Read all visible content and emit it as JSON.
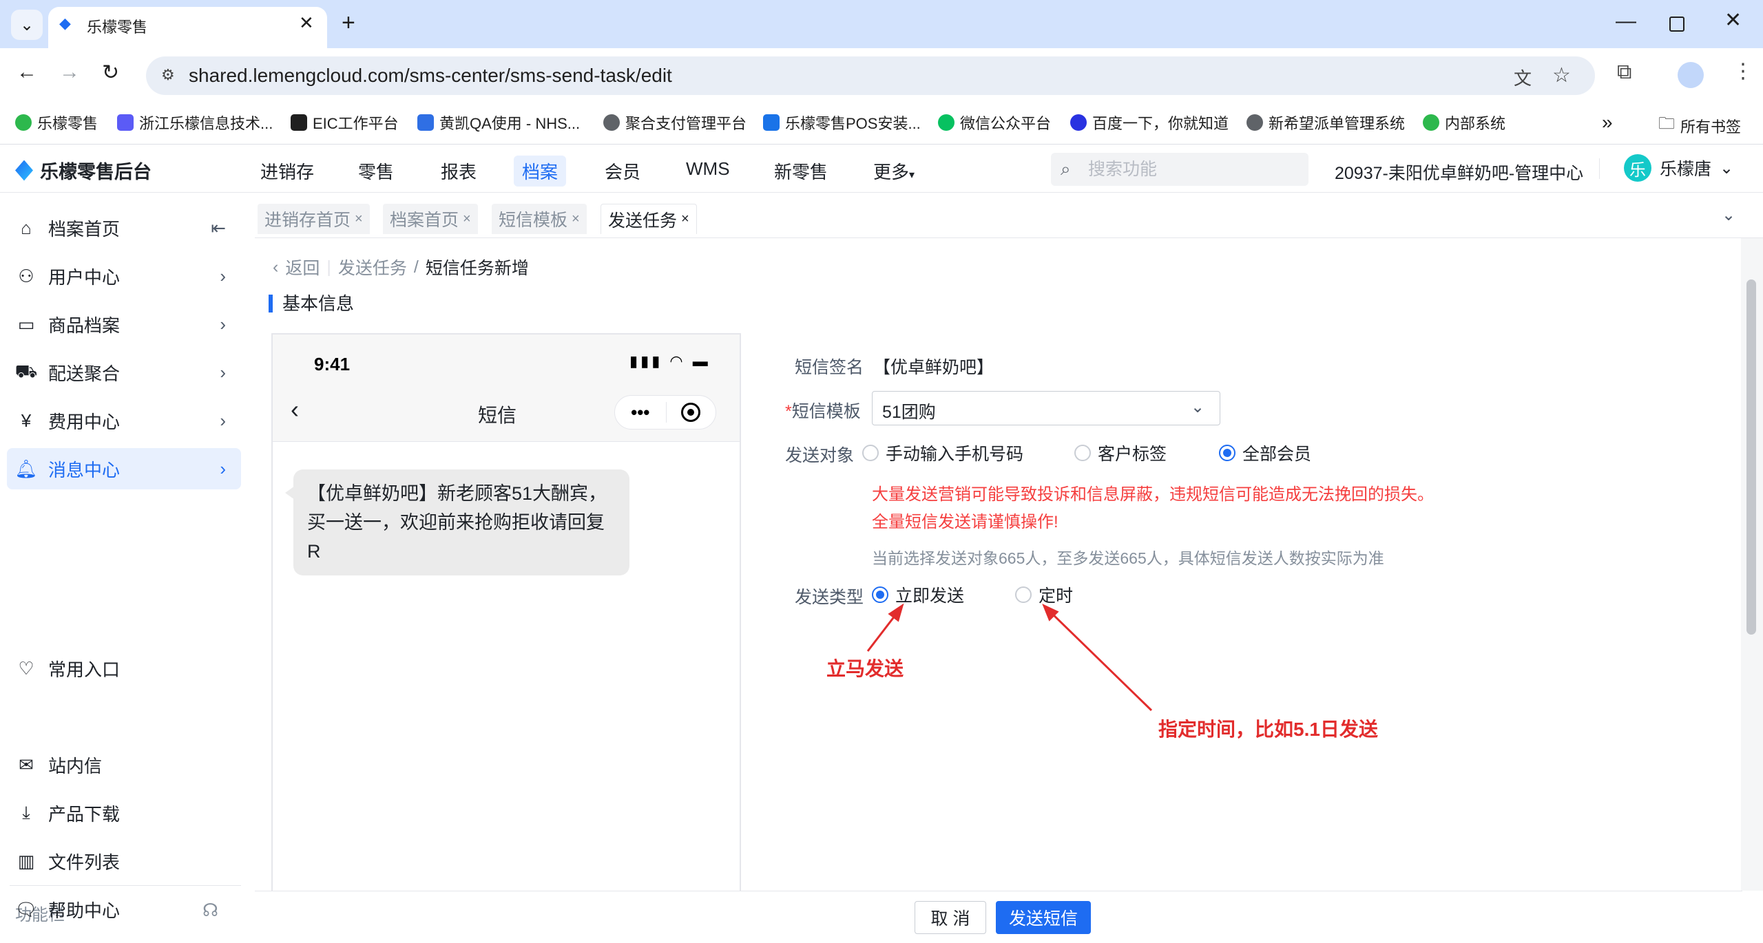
{
  "browser": {
    "tab_title": "乐檬零售",
    "url": "shared.lemengcloud.com/sms-center/sms-send-task/edit",
    "bookmarks": [
      "乐檬零售",
      "浙江乐檬信息技术...",
      "EIC工作平台",
      "黄凯QA使用 - NHS...",
      "聚合支付管理平台",
      "乐檬零售POS安装...",
      "微信公众平台",
      "百度一下，你就知道",
      "新希望派单管理系统",
      "内部系统"
    ],
    "bookmarks_more": "»",
    "all_bookmarks": "所有书签"
  },
  "app": {
    "logo": "乐檬零售后台",
    "nav": [
      "进销存",
      "零售",
      "报表",
      "档案",
      "会员",
      "WMS",
      "新零售",
      "更多"
    ],
    "active_nav": "档案",
    "search_placeholder": "搜索功能",
    "store_name": "20937-耒阳优卓鲜奶吧-管理中心",
    "user_avatar": "乐",
    "user_name": "乐檬唐"
  },
  "sidebar": {
    "items": [
      {
        "label": "档案首页",
        "icon": "home-icon"
      },
      {
        "label": "用户中心",
        "icon": "user-icon"
      },
      {
        "label": "商品档案",
        "icon": "box-icon"
      },
      {
        "label": "配送聚合",
        "icon": "truck-icon"
      },
      {
        "label": "费用中心",
        "icon": "yen-icon"
      },
      {
        "label": "消息中心",
        "icon": "bell-icon"
      }
    ],
    "favorites": "常用入口",
    "section": "功能栏",
    "tools": [
      {
        "label": "站内信",
        "icon": "mail-icon"
      },
      {
        "label": "产品下载",
        "icon": "download-icon"
      },
      {
        "label": "文件列表",
        "icon": "chart-icon"
      },
      {
        "label": "帮助中心",
        "icon": "help-icon"
      }
    ]
  },
  "page_tabs": [
    "进销存首页",
    "档案首页",
    "短信模板",
    "发送任务"
  ],
  "breadcrumb": {
    "back": "返回",
    "parent": "发送任务",
    "sep": "/",
    "current": "短信任务新增"
  },
  "section_title": "基本信息",
  "phone": {
    "time": "9:41",
    "title": "短信",
    "message": "【优卓鲜奶吧】新老顾客51大酬宾，买一送一，欢迎前来抢购拒收请回复R"
  },
  "form": {
    "signature_label": "短信签名",
    "signature_value": "【优卓鲜奶吧】",
    "template_label": "短信模板",
    "template_value": "51团购",
    "target_label": "发送对象",
    "target_options": [
      "手动输入手机号码",
      "客户标签",
      "全部会员"
    ],
    "target_selected": "全部会员",
    "warning_1": "大量发送营销可能导致投诉和信息屏蔽，违规短信可能造成无法挽回的损失。",
    "warning_2": "全量短信发送请谨慎操作!",
    "hint": "当前选择发送对象665人，至多发送665人，具体短信发送人数按实际为准",
    "type_label": "发送类型",
    "type_options": [
      "立即发送",
      "定时"
    ],
    "type_selected": "立即发送"
  },
  "annotations": {
    "immediate": "立马发送",
    "scheduled": "指定时间，比如5.1日发送",
    "color": "#e22c2c"
  },
  "footer": {
    "cancel": "取 消",
    "send": "发送短信"
  },
  "colors": {
    "primary": "#1e6cf2",
    "danger": "#f53f3f"
  }
}
